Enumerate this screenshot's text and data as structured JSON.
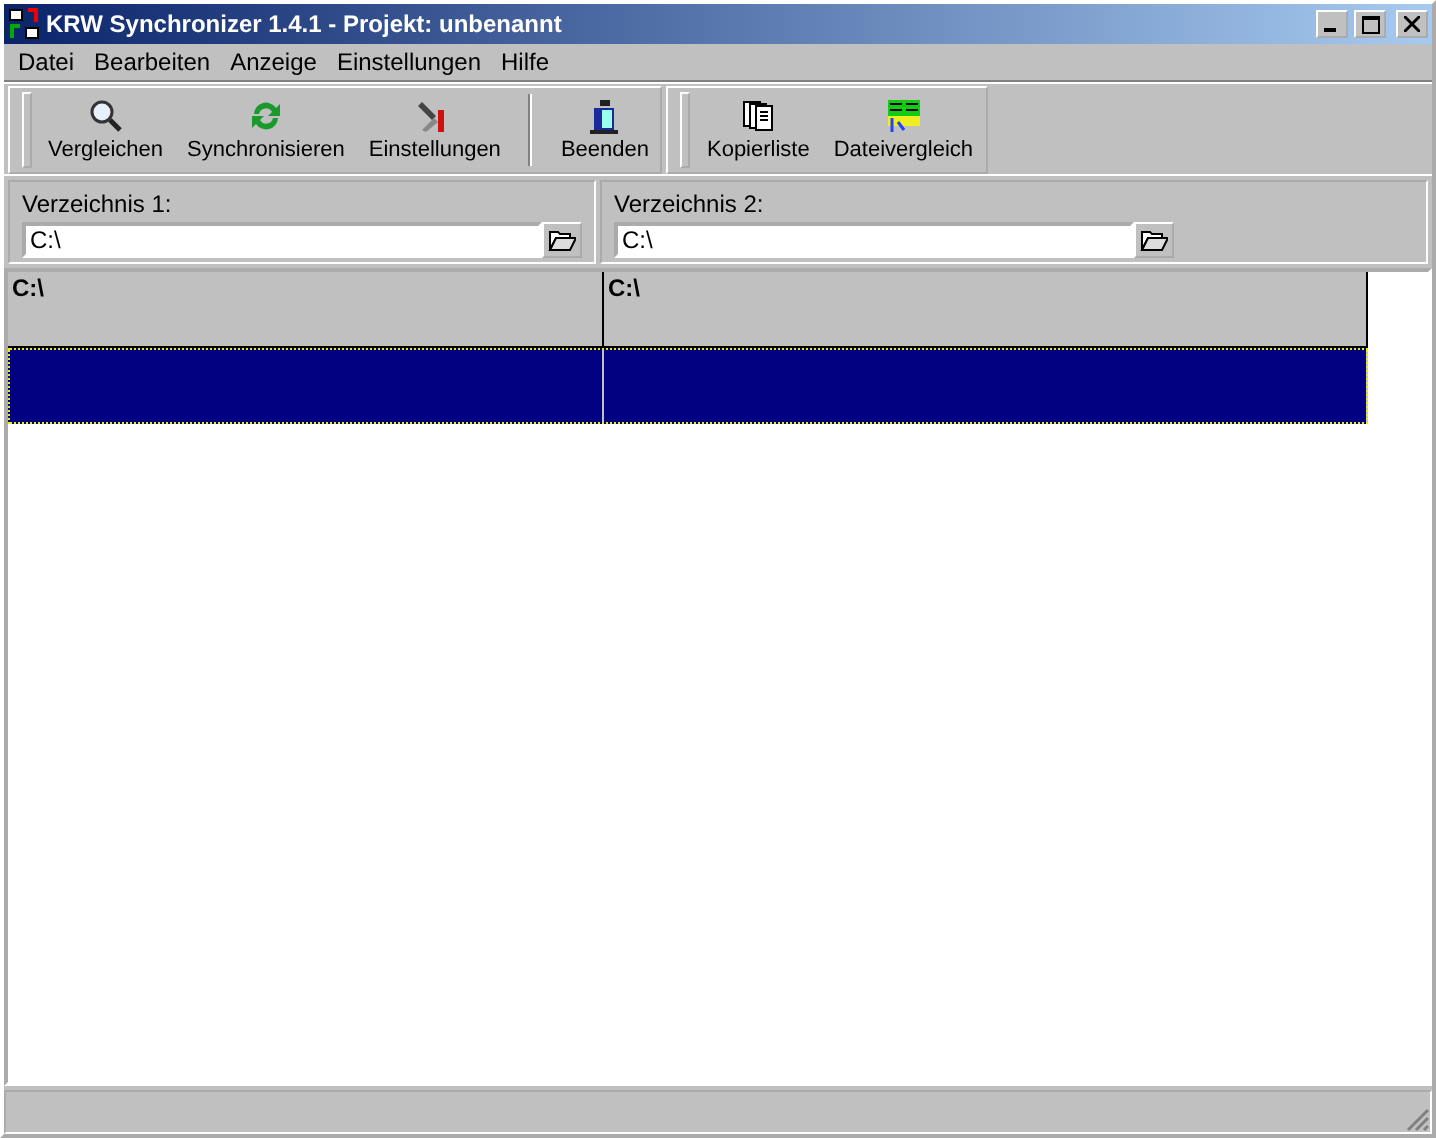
{
  "window": {
    "title": "KRW Synchronizer 1.4.1 - Projekt: unbenannt"
  },
  "menu": [
    "Datei",
    "Bearbeiten",
    "Anzeige",
    "Einstellungen",
    "Hilfe"
  ],
  "toolbar": [
    [
      {
        "label": "Vergleichen",
        "kind": "magnifier"
      },
      {
        "label": "Synchronisieren",
        "kind": "sync"
      },
      {
        "label": "Einstellungen",
        "kind": "tools"
      },
      {
        "label": "Beenden",
        "kind": "exit",
        "separated": true
      }
    ],
    [
      {
        "label": "Kopierliste",
        "kind": "copylist"
      },
      {
        "label": "Dateivergleich",
        "kind": "filecompare"
      }
    ]
  ],
  "directories": [
    {
      "label": "Verzeichnis 1:",
      "value": "C:\\"
    },
    {
      "label": "Verzeichnis 2:",
      "value": "C:\\"
    }
  ],
  "table": {
    "columns": [
      "C:\\",
      "C:\\"
    ],
    "rows": [
      {
        "selected": true
      }
    ]
  }
}
